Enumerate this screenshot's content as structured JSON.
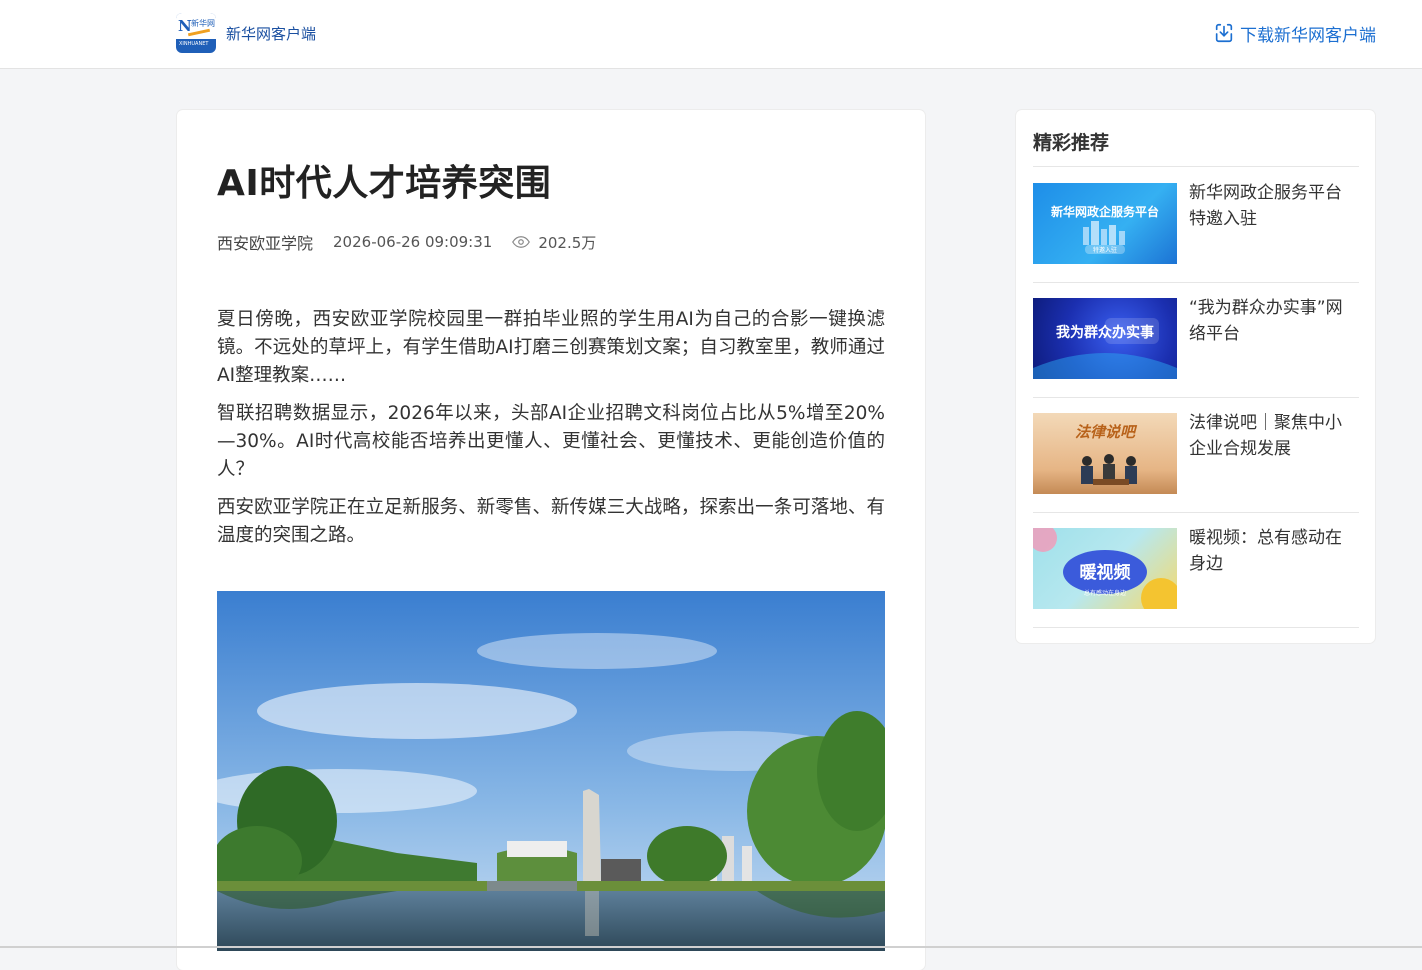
{
  "header": {
    "logo_n": "N",
    "logo_cn": "新华网",
    "logo_en": "XINHUANET",
    "brand": "新华网客户端",
    "download_label": "下载新华网客户端"
  },
  "article": {
    "title": "AI时代人才培养突围",
    "source": "西安欧亚学院",
    "time": "2026-06-26 09:09:31",
    "views": "202.5万",
    "paragraphs": [
      "夏日傍晚，西安欧亚学院校园里一群拍毕业照的学生用AI为自己的合影一键换滤镜。不远处的草坪上，有学生借助AI打磨三创赛策划文案；自习教室里，教师通过AI整理教案……",
      "智联招聘数据显示，2026年以来，头部AI企业招聘文科岗位占比从5%增至20%—30%。AI时代高校能否培养出更懂人、更懂社会、更懂技术、更能创造价值的人？",
      "西安欧亚学院正在立足新服务、新零售、新传媒三大战略，探索出一条可落地、有温度的突围之路。"
    ]
  },
  "sidebar": {
    "title": "精彩推荐",
    "items": [
      {
        "text": "新华网政企服务平台特邀入驻",
        "thumb_label": "新华网政企服务平台",
        "thumb_sub": "特邀入驻"
      },
      {
        "text": "“我为群众办实事”网络平台",
        "thumb_label": "我为群众办实事",
        "thumb_sub": ""
      },
      {
        "text": "法律说吧｜聚焦中小企业合规发展",
        "thumb_label": "法律说吧",
        "thumb_sub": ""
      },
      {
        "text": "暖视频：总有感动在身边",
        "thumb_label": "暖视频",
        "thumb_sub": "总有感动在身边"
      }
    ]
  },
  "colors": {
    "accent": "#1c6fd1",
    "brand": "#1a4fa0",
    "background": "#f4f5f7"
  },
  "icons": {
    "download": "download-icon",
    "views": "eye-icon"
  }
}
